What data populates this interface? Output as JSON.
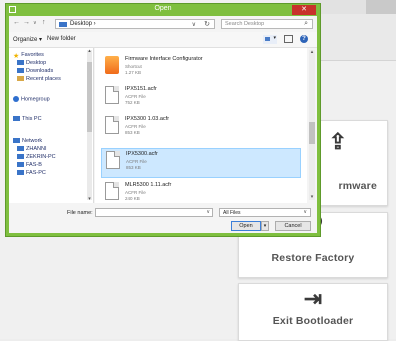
{
  "app": {
    "buttons": [
      {
        "label": "rmware",
        "icon": "upload-icon"
      },
      {
        "label": "Restore Factory",
        "icon": "restore-icon"
      },
      {
        "label": "Exit Bootloader",
        "icon": "exit-icon"
      }
    ]
  },
  "dialog": {
    "title": "Open",
    "close_glyph": "✕",
    "nav_glyphs": {
      "back": "←",
      "forward": "→",
      "dropdown": "∨",
      "up": "↑"
    },
    "address": {
      "path": "Desktop  ›",
      "dropdown": "∨",
      "refresh": "↻"
    },
    "search": {
      "placeholder": "Search Desktop",
      "icon": "search-icon"
    },
    "toolbar": {
      "organize": "Organize ▾",
      "new_folder": "New folder",
      "help": "?"
    },
    "navigation": [
      {
        "label": "Favorites",
        "icon": "star-icon",
        "color": "#f0b400"
      },
      {
        "label": "Desktop",
        "icon": "desktop-icon",
        "color": "#3a74c8"
      },
      {
        "label": "Downloads",
        "icon": "downloads-icon",
        "color": "#3a74c8"
      },
      {
        "label": "Recent places",
        "icon": "recent-places-icon",
        "color": "#d8a848"
      },
      {
        "label": "Homegroup",
        "icon": "homegroup-icon",
        "color": "#2e6fcf"
      },
      {
        "label": "This PC",
        "icon": "computer-icon",
        "color": "#3a74c8"
      },
      {
        "label": "Network",
        "icon": "network-icon",
        "color": "#3a74c8"
      },
      {
        "label": "ZHANNI",
        "icon": "network-pc-icon",
        "color": "#3a74c8"
      },
      {
        "label": "ZEKRIN-PC",
        "icon": "network-pc-icon",
        "color": "#3a74c8"
      },
      {
        "label": "FAS-B",
        "icon": "network-pc-icon",
        "color": "#3a74c8"
      },
      {
        "label": "FAS-PC",
        "icon": "network-pc-icon",
        "color": "#3a74c8"
      }
    ],
    "files": [
      {
        "name": "Firmware Interface Configurator",
        "type": "Shortcut",
        "size": "1.27 KB",
        "icon": "config-app-icon",
        "selected": false
      },
      {
        "name": "IPX5151.acfr",
        "type": "ACFR File",
        "size": "752 KB",
        "icon": "file-icon",
        "selected": false
      },
      {
        "name": "IPX5300 1.03.acfr",
        "type": "ACFR File",
        "size": "853 KB",
        "icon": "file-icon",
        "selected": false
      },
      {
        "name": "IPX5300.acfr",
        "type": "ACFR File",
        "size": "853 KB",
        "icon": "file-icon",
        "selected": true
      },
      {
        "name": "MLR5300 1.11.acfr",
        "type": "ACFR File",
        "size": "240 KB",
        "icon": "file-icon",
        "selected": false
      }
    ],
    "filename": {
      "label": "File name:",
      "value": "",
      "dropdown": "∨"
    },
    "filetype": {
      "value": "All Files",
      "dropdown": "∨"
    },
    "open_label": "Open",
    "open_split_glyph": "▾",
    "cancel_label": "Cancel",
    "scroll_glyphs": {
      "up": "▴",
      "down": "▾"
    }
  },
  "colors": {
    "title_bar": "#7fbf3f",
    "close": "#c8312b",
    "selection": "#cde8ff"
  }
}
